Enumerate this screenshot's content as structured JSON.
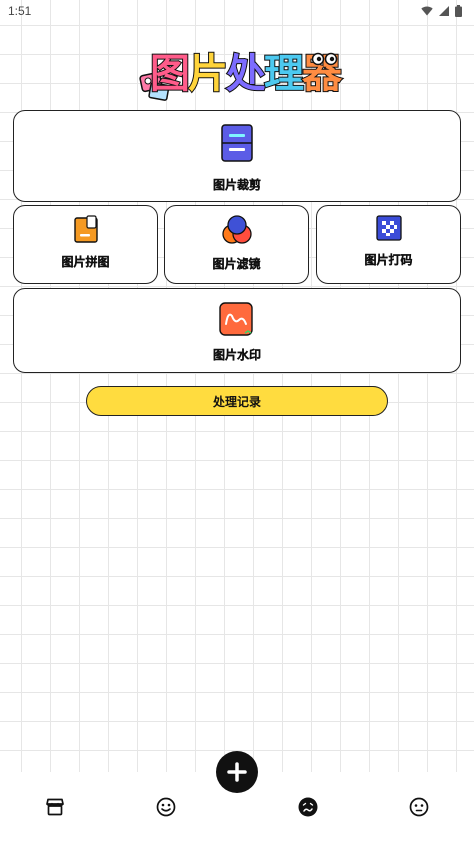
{
  "status_bar": {
    "time": "1:51",
    "icons": [
      "wifi-icon",
      "cell-signal-icon",
      "battery-icon"
    ]
  },
  "logo": {
    "title_chars": [
      "图",
      "片",
      "处",
      "理",
      "器"
    ],
    "title": "图片处理器"
  },
  "tools": {
    "crop": {
      "label": "图片裁剪",
      "icon": "crop-icon",
      "color": "#5b5ce6"
    },
    "collage": {
      "label": "图片拼图",
      "icon": "collage-icon",
      "color": "#f59a23"
    },
    "filter": {
      "label": "图片滤镜",
      "icon": "filter-icon",
      "color": "#3f51d6"
    },
    "mosaic": {
      "label": "图片打码",
      "icon": "mosaic-icon",
      "color": "#3b4cd8"
    },
    "watermark": {
      "label": "图片水印",
      "icon": "watermark-icon",
      "color": "#ff6a3d"
    }
  },
  "history_button": {
    "label": "处理记录",
    "color": "#ffdc3f"
  },
  "bottom_nav": {
    "items": [
      {
        "name": "shop-icon"
      },
      {
        "name": "smile-icon"
      },
      {
        "name": "sad-face-icon"
      },
      {
        "name": "neutral-face-icon"
      }
    ],
    "fab": "plus-icon"
  }
}
